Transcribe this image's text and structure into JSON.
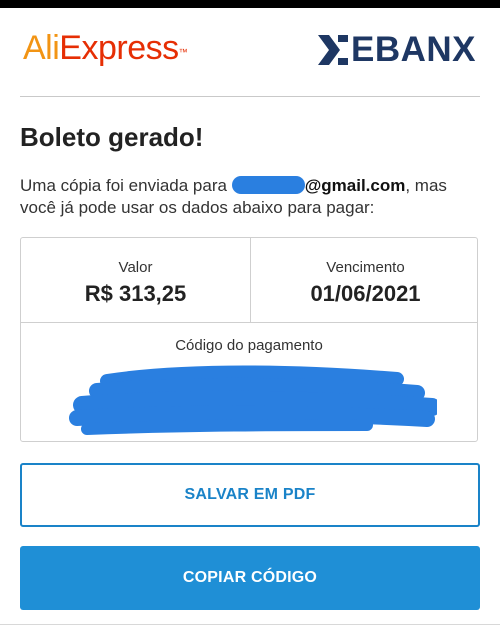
{
  "header": {
    "aliexpress_logo_part1": "Ali",
    "aliexpress_logo_part2": "Express",
    "aliexpress_logo_tm": "™",
    "ebanx_logo": "EBANX"
  },
  "page": {
    "title": "Boleto gerado!",
    "description_prefix": "Uma cópia foi enviada para ",
    "email_visible_part": "@gmail.com",
    "description_suffix": ", mas você já pode usar os dados abaixo para pagar:"
  },
  "payment": {
    "valor_label": "Valor",
    "valor_value": "R$ 313,25",
    "vencimento_label": "Vencimento",
    "vencimento_value": "01/06/2021",
    "codigo_label": "Código do pagamento"
  },
  "buttons": {
    "save_pdf": "SALVAR EM PDF",
    "copy_code": "COPIAR CÓDIGO"
  },
  "colors": {
    "ali_orange": "#f29414",
    "ali_red": "#e62e04",
    "ebanx_navy": "#1e3763",
    "accent_blue": "#1f8fd6",
    "redaction_blue": "#2a7fe0"
  }
}
